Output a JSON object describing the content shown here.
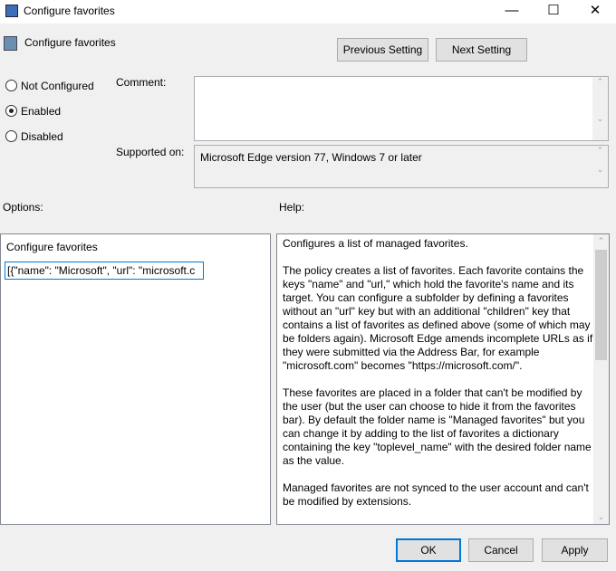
{
  "window": {
    "title": "Configure favorites",
    "minimize": "—",
    "maximize": "☐",
    "close": "✕"
  },
  "header": {
    "policy_name": "Configure favorites",
    "previous": "Previous Setting",
    "next": "Next Setting"
  },
  "state": {
    "options": [
      "Not Configured",
      "Enabled",
      "Disabled"
    ],
    "selected": "Enabled"
  },
  "comment": {
    "label": "Comment:",
    "value": ""
  },
  "supported": {
    "label": "Supported on:",
    "value": "Microsoft Edge version 77, Windows 7 or later"
  },
  "options": {
    "label": "Options:",
    "field_label": "Configure favorites",
    "field_value": "[{\"name\": \"Microsoft\", \"url\": \"microsoft.c"
  },
  "help": {
    "label": "Help:",
    "paragraphs": [
      "Configures a list of managed favorites.",
      "The policy creates a list of favorites. Each favorite contains the keys \"name\" and \"url,\" which hold the favorite's name and its target. You can configure a subfolder by defining a favorites without an \"url\" key but with an additional \"children\" key that contains a list of favorites as defined above (some of which may be folders again). Microsoft Edge amends incomplete URLs as if they were submitted via the Address Bar, for example \"microsoft.com\" becomes \"https://microsoft.com/\".",
      "These favorites are placed in a folder that can't be modified by the user (but the user can choose to hide it from the favorites bar). By default the folder name is \"Managed favorites\" but you can change it by adding to the list of favorites a dictionary containing the key \"toplevel_name\" with the desired folder name as the value.",
      "Managed favorites are not synced to the user account and can't be modified by extensions."
    ]
  },
  "footer": {
    "ok": "OK",
    "cancel": "Cancel",
    "apply": "Apply"
  }
}
